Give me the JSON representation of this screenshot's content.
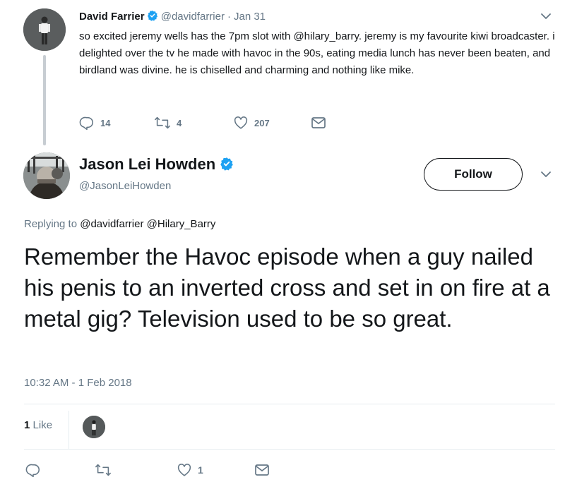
{
  "parent_tweet": {
    "author_name": "David Farrier",
    "handle": "@davidfarrier",
    "separator": "·",
    "date": "Jan 31",
    "text": "so excited jeremy wells has the 7pm slot with @hilary_barry. jeremy is my favourite kiwi broadcaster. i delighted over the tv he made with havoc in the 90s, eating media lunch has never been beaten, and birdland was divine. he is chiselled and charming and nothing like mike.",
    "replies": "14",
    "retweets": "4",
    "likes": "207"
  },
  "main_tweet": {
    "author_name": "Jason Lei Howden",
    "handle": "@JasonLeiHowden",
    "follow_label": "Follow",
    "replying_prefix": "Replying to",
    "replying_to_1": "@davidfarrier",
    "replying_to_2": "@Hilary_Barry",
    "text": "Remember the Havoc episode when a guy nailed his penis to an inverted cross and set in on fire at a metal gig? Television used to be so great.",
    "timestamp": "10:32 AM - 1 Feb 2018",
    "like_count": "1",
    "like_word": "Like",
    "action_like_count": "1"
  },
  "icons": {
    "verified": "verified-badge-icon",
    "caret": "chevron-down-icon",
    "reply": "reply-icon",
    "retweet": "retweet-icon",
    "like": "heart-icon",
    "dm": "envelope-icon"
  },
  "colors": {
    "verified": "#1da1f2",
    "muted": "#657786",
    "text": "#14171a",
    "divider": "#e6ecf0"
  }
}
